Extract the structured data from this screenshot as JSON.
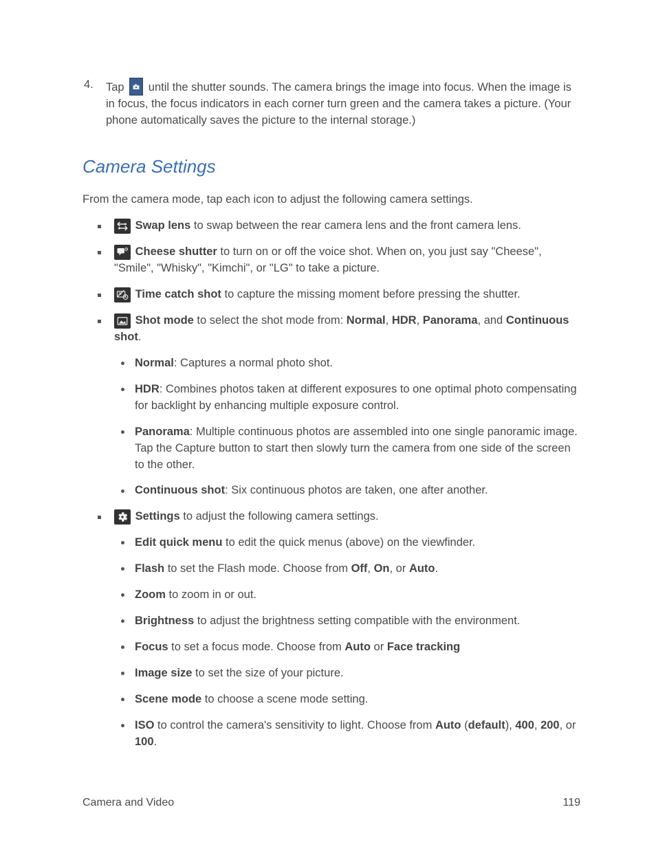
{
  "step4": {
    "num": "4.",
    "before": "Tap ",
    "after": " until the shutter sounds. The camera brings the image into focus. When the image is in focus, the focus indicators in each corner turn green and the camera takes a picture. (Your phone automatically saves the picture to the internal storage.)"
  },
  "section_title": "Camera Settings",
  "intro": "From the camera mode, tap each icon to adjust the following camera settings.",
  "features": {
    "swap_lens": {
      "name": "Swap lens",
      "desc": " to swap between the rear camera lens and the front camera lens."
    },
    "cheese": {
      "name": "Cheese shutter",
      "desc": " to turn on or off the voice shot. When on, you just say \"Cheese\", \"Smile\", \"Whisky\", \"Kimchi\", or \"LG\" to take a picture."
    },
    "time_catch": {
      "name": "Time catch shot",
      "desc": " to capture the missing moment before pressing the shutter."
    },
    "shot_mode": {
      "name": "Shot mode",
      "pre": " to select the shot mode from: ",
      "sep": ", ",
      "and": ", and ",
      "period": ".",
      "normal_b": "Normal",
      "hdr_b": "HDR",
      "pano_b": "Panorama",
      "cont_b": "Continuous shot",
      "items": {
        "normal": {
          "name": "Normal",
          "desc": ": Captures a normal photo shot."
        },
        "hdr": {
          "name": "HDR",
          "desc": ": Combines photos taken at different exposures to one optimal photo compensating for backlight by enhancing multiple exposure control."
        },
        "panorama": {
          "name": "Panorama",
          "desc": ": Multiple continuous photos are assembled into one single panoramic image. Tap the Capture button to start then slowly turn the camera from one side of the screen to the other."
        },
        "continuous": {
          "name": "Continuous shot",
          "desc": ": Six continuous photos are taken, one after another."
        }
      }
    },
    "settings": {
      "name": "Settings",
      "desc": " to adjust the following camera settings.",
      "items": {
        "edit_quick": {
          "name": "Edit quick menu",
          "desc": " to edit the quick menus (above) on the viewfinder."
        },
        "flash": {
          "name": "Flash",
          "pre": " to set the Flash mode. Choose from ",
          "off": "Off",
          "sep": ", ",
          "on": "On",
          "or": ", or ",
          "auto": "Auto",
          "period": "."
        },
        "zoom": {
          "name": "Zoom",
          "desc": " to zoom in or out."
        },
        "brightness": {
          "name": "Brightness",
          "desc": " to adjust the brightness setting compatible with the environment."
        },
        "focus": {
          "name": "Focus",
          "pre": " to set a focus mode. Choose from ",
          "auto": "Auto",
          "or": " or ",
          "face": "Face tracking"
        },
        "image_size": {
          "name": "Image size",
          "desc": " to set the size of your picture."
        },
        "scene_mode": {
          "name": "Scene mode",
          "desc": " to choose a scene mode setting."
        },
        "iso": {
          "name": "ISO",
          "pre": " to control the camera's sensitivity to light. Choose from ",
          "auto": "Auto",
          "open": " (",
          "default": "default",
          "close": "), ",
          "v400": "400",
          "sep": ", ",
          "v200": "200",
          "or": ", or ",
          "v100": "100",
          "period": "."
        }
      }
    }
  },
  "footer": {
    "left": "Camera and Video",
    "right": "119"
  }
}
